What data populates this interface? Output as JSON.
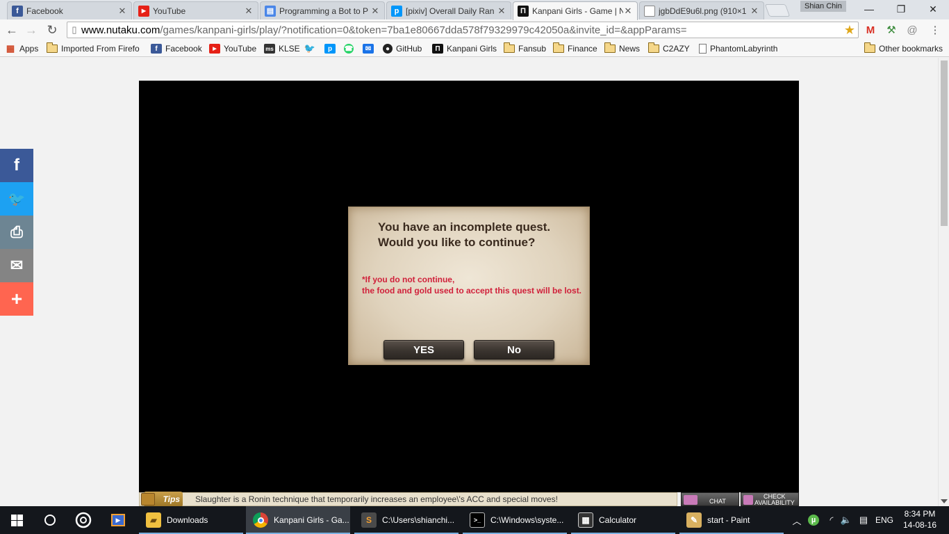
{
  "browser": {
    "tabs": [
      {
        "title": "Facebook",
        "icon": "facebook-icon",
        "color": "#3b5998",
        "glyph": "f"
      },
      {
        "title": "YouTube",
        "icon": "youtube-icon",
        "color": "#e62117",
        "glyph": "▶"
      },
      {
        "title": "Programming a Bot to P",
        "icon": "google-docs-icon",
        "color": "#4a86e8",
        "glyph": "▤"
      },
      {
        "title": "[pixiv] Overall Daily Ran",
        "icon": "pixiv-icon",
        "color": "#0096fa",
        "glyph": "p"
      },
      {
        "title": "Kanpani Girls - Game | N",
        "icon": "nutaku-icon",
        "color": "#111111",
        "glyph": "Π"
      },
      {
        "title": "jgbDdE9u6l.png (910×1",
        "icon": "image-file-icon",
        "color": "#888888",
        "glyph": ""
      }
    ],
    "profile_name": "Shian Chin",
    "url_domain": "www.nutaku.com",
    "url_path": "/games/kanpani-girls/play/?notification=0&token=7ba1e80667dda578f79329979c42050a&invite_id=&appParams=",
    "bookmarks": [
      {
        "label": "Apps",
        "type": "apps"
      },
      {
        "label": "Imported From Firefo",
        "type": "folder"
      },
      {
        "label": "Facebook",
        "type": "site",
        "color": "#3b5998",
        "glyph": "f"
      },
      {
        "label": "YouTube",
        "type": "site",
        "color": "#e62117",
        "glyph": "▶"
      },
      {
        "label": "KLSE",
        "type": "site",
        "color": "#333333",
        "glyph": "ms"
      },
      {
        "label": "",
        "type": "site",
        "color": "#1da1f2",
        "glyph": "t"
      },
      {
        "label": "",
        "type": "site",
        "color": "#0096fa",
        "glyph": "p"
      },
      {
        "label": "",
        "type": "site",
        "color": "#25d366",
        "glyph": "w"
      },
      {
        "label": "",
        "type": "site",
        "color": "#1a73e8",
        "glyph": "✉"
      },
      {
        "label": "GitHub",
        "type": "site",
        "color": "#222222",
        "glyph": "●"
      },
      {
        "label": "Kanpani Girls",
        "type": "site",
        "color": "#111111",
        "glyph": "Π"
      },
      {
        "label": "Fansub",
        "type": "folder"
      },
      {
        "label": "Finance",
        "type": "folder"
      },
      {
        "label": "News",
        "type": "folder"
      },
      {
        "label": "C2AZY",
        "type": "folder"
      },
      {
        "label": "PhantomLabyrinth",
        "type": "doc"
      },
      {
        "label": "Other bookmarks",
        "type": "folder"
      }
    ]
  },
  "share_bar": [
    {
      "name": "facebook-share-icon",
      "glyph": "f",
      "color": "#3b5998"
    },
    {
      "name": "twitter-share-icon",
      "glyph": "🐦",
      "color": "#1da1f2"
    },
    {
      "name": "print-share-icon",
      "glyph": "⎙",
      "color": "#6d8593"
    },
    {
      "name": "email-share-icon",
      "glyph": "✉",
      "color": "#848484"
    },
    {
      "name": "more-share-icon",
      "glyph": "+",
      "color": "#ff6550"
    }
  ],
  "dialog": {
    "line1": "You have an incomplete quest.",
    "line2": "Would you like to continue?",
    "warning1": "*If you do not continue,",
    "warning2": "the food and gold used to accept this quest will be lost.",
    "yes_label": "YES",
    "no_label": "No"
  },
  "tips": {
    "label": "Tips",
    "text": "Slaughter is a Ronin technique that temporarily increases an employee\\'s ACC and special moves!"
  },
  "side_buttons": {
    "chat": "CHAT",
    "check1": "CHECK",
    "check2": "AVAILABILITY"
  },
  "taskbar": {
    "apps": [
      {
        "label": "Downloads",
        "icon": "file-explorer-icon",
        "color": "#f0c040",
        "glyph": "▰"
      },
      {
        "label": "Kanpani Girls - Ga...",
        "icon": "chrome-icon",
        "color": "#4285f4",
        "glyph": "◉",
        "active": true
      },
      {
        "label": "C:\\Users\\shianchi...",
        "icon": "sublime-text-icon",
        "color": "#4a4a4a",
        "glyph": "S"
      },
      {
        "label": "C:\\Windows\\syste...",
        "icon": "cmd-icon",
        "color": "#000000",
        "glyph": ">_"
      },
      {
        "label": "Calculator",
        "icon": "calculator-icon",
        "color": "#333333",
        "glyph": "▦"
      },
      {
        "label": "start - Paint",
        "icon": "paint-icon",
        "color": "#d8b060",
        "glyph": "🎨"
      }
    ],
    "language": "ENG",
    "time": "8:34 PM",
    "date": "14-08-16"
  }
}
